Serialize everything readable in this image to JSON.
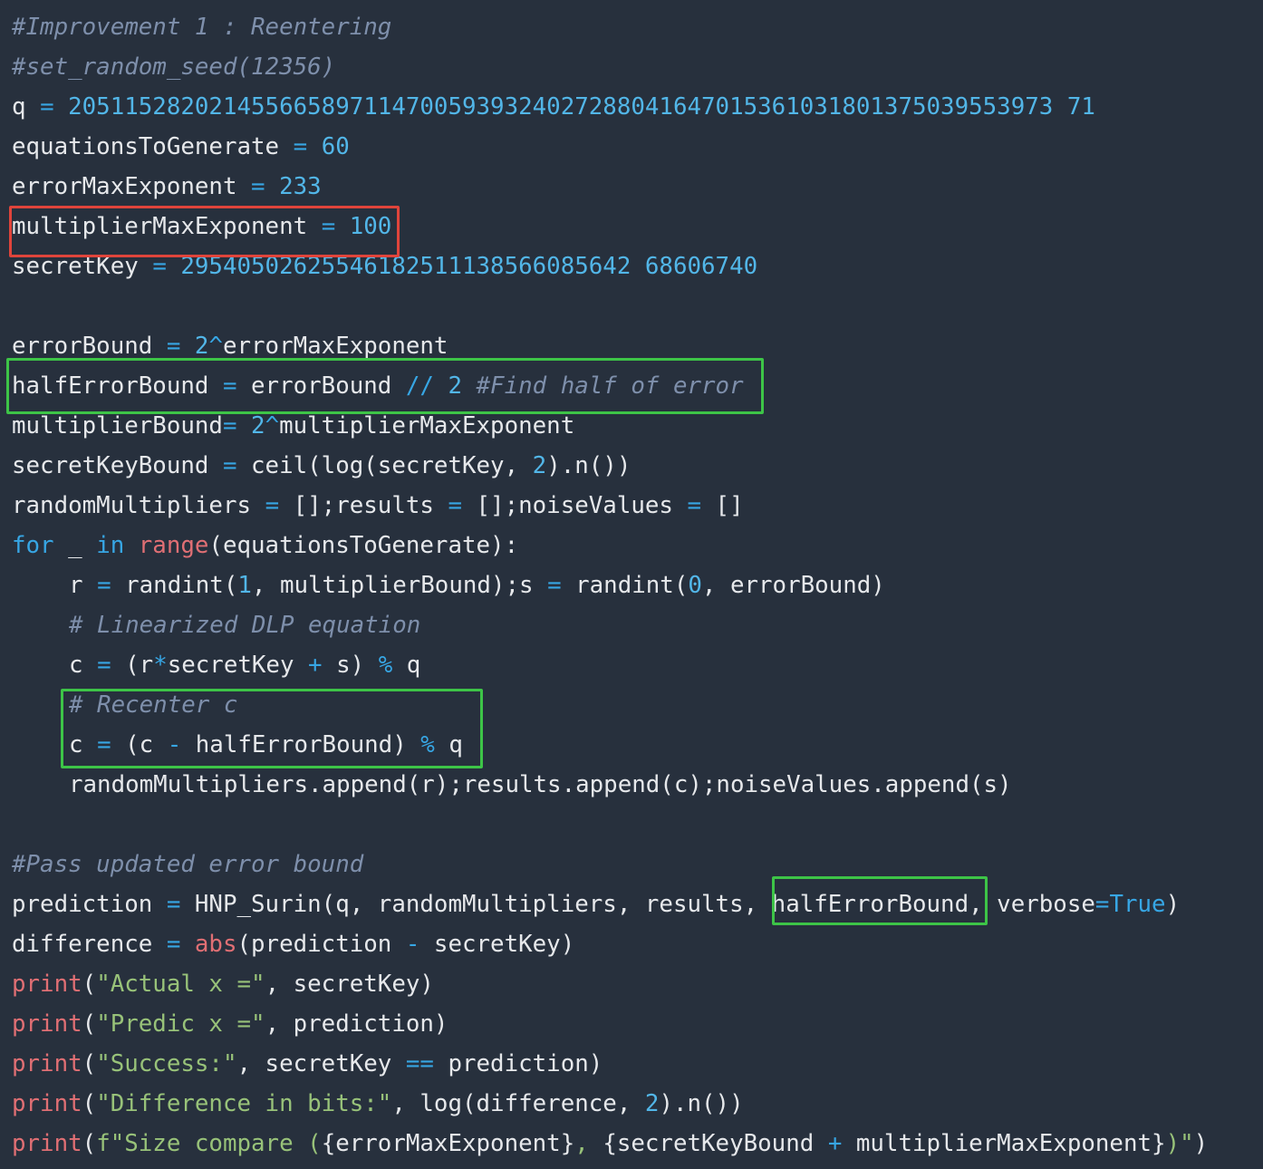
{
  "theme": {
    "background": "#27303d",
    "plain": "#e6e8eb",
    "comment": "#7e8fab",
    "keyword": "#37a6e4",
    "number": "#52b6e8",
    "builtin": "#e06f74",
    "string": "#98c279",
    "highlight_red": "#e0443b",
    "highlight_green": "#3dc447"
  },
  "code": {
    "lines": [
      {
        "indent": false,
        "tokens": [
          {
            "t": "cm",
            "v": "#Improvement 1 : Reentering"
          }
        ]
      },
      {
        "indent": false,
        "tokens": [
          {
            "t": "cm",
            "v": "#set_random_seed(12356)"
          }
        ]
      },
      {
        "indent": false,
        "tokens": [
          {
            "t": "txt",
            "v": "q "
          },
          {
            "t": "op",
            "v": "="
          },
          {
            "t": "txt",
            "v": " "
          },
          {
            "t": "num",
            "v": "2051152820214556658971147005939324027288041647015361031801375039553973 71"
          }
        ]
      },
      {
        "indent": false,
        "tokens": [
          {
            "t": "txt",
            "v": "equationsToGenerate "
          },
          {
            "t": "op",
            "v": "="
          },
          {
            "t": "txt",
            "v": " "
          },
          {
            "t": "num",
            "v": "60"
          }
        ]
      },
      {
        "indent": false,
        "tokens": [
          {
            "t": "txt",
            "v": "errorMaxExponent "
          },
          {
            "t": "op",
            "v": "="
          },
          {
            "t": "txt",
            "v": " "
          },
          {
            "t": "num",
            "v": "233"
          }
        ]
      },
      {
        "indent": false,
        "tokens": [
          {
            "t": "txt",
            "v": "multiplierMaxExponent "
          },
          {
            "t": "op",
            "v": "="
          },
          {
            "t": "txt",
            "v": " "
          },
          {
            "t": "num",
            "v": "100"
          }
        ]
      },
      {
        "indent": false,
        "tokens": [
          {
            "t": "txt",
            "v": "secretKey "
          },
          {
            "t": "op",
            "v": "="
          },
          {
            "t": "txt",
            "v": " "
          },
          {
            "t": "num",
            "v": "29540502625546182511138566085642 68606740"
          }
        ]
      },
      {
        "indent": false,
        "tokens": []
      },
      {
        "indent": false,
        "tokens": [
          {
            "t": "txt",
            "v": "errorBound "
          },
          {
            "t": "op",
            "v": "="
          },
          {
            "t": "txt",
            "v": " "
          },
          {
            "t": "num",
            "v": "2"
          },
          {
            "t": "op",
            "v": "^"
          },
          {
            "t": "txt",
            "v": "errorMaxExponent"
          }
        ]
      },
      {
        "indent": false,
        "tokens": [
          {
            "t": "txt",
            "v": "halfErrorBound "
          },
          {
            "t": "op",
            "v": "="
          },
          {
            "t": "txt",
            "v": " errorBound "
          },
          {
            "t": "op",
            "v": "//"
          },
          {
            "t": "txt",
            "v": " "
          },
          {
            "t": "num",
            "v": "2"
          },
          {
            "t": "txt",
            "v": " "
          },
          {
            "t": "cm",
            "v": "#Find half of error"
          }
        ]
      },
      {
        "indent": false,
        "tokens": [
          {
            "t": "txt",
            "v": "multiplierBound"
          },
          {
            "t": "op",
            "v": "="
          },
          {
            "t": "txt",
            "v": " "
          },
          {
            "t": "num",
            "v": "2"
          },
          {
            "t": "op",
            "v": "^"
          },
          {
            "t": "txt",
            "v": "multiplierMaxExponent"
          }
        ]
      },
      {
        "indent": false,
        "tokens": [
          {
            "t": "txt",
            "v": "secretKeyBound "
          },
          {
            "t": "op",
            "v": "="
          },
          {
            "t": "txt",
            "v": " ceil(log(secretKey, "
          },
          {
            "t": "num",
            "v": "2"
          },
          {
            "t": "txt",
            "v": ").n())"
          }
        ]
      },
      {
        "indent": false,
        "tokens": [
          {
            "t": "txt",
            "v": "randomMultipliers "
          },
          {
            "t": "op",
            "v": "="
          },
          {
            "t": "txt",
            "v": " [];results "
          },
          {
            "t": "op",
            "v": "="
          },
          {
            "t": "txt",
            "v": " [];noiseValues "
          },
          {
            "t": "op",
            "v": "="
          },
          {
            "t": "txt",
            "v": " []"
          }
        ]
      },
      {
        "indent": false,
        "tokens": [
          {
            "t": "kw",
            "v": "for"
          },
          {
            "t": "txt",
            "v": " _ "
          },
          {
            "t": "kw",
            "v": "in"
          },
          {
            "t": "txt",
            "v": " "
          },
          {
            "t": "fn",
            "v": "range"
          },
          {
            "t": "txt",
            "v": "(equationsToGenerate):"
          }
        ]
      },
      {
        "indent": true,
        "tokens": [
          {
            "t": "txt",
            "v": "r "
          },
          {
            "t": "op",
            "v": "="
          },
          {
            "t": "txt",
            "v": " randint("
          },
          {
            "t": "num",
            "v": "1"
          },
          {
            "t": "txt",
            "v": ", multiplierBound);s "
          },
          {
            "t": "op",
            "v": "="
          },
          {
            "t": "txt",
            "v": " randint("
          },
          {
            "t": "num",
            "v": "0"
          },
          {
            "t": "txt",
            "v": ", errorBound)"
          }
        ]
      },
      {
        "indent": true,
        "tokens": [
          {
            "t": "cm",
            "v": "# Linearized DLP equation"
          }
        ]
      },
      {
        "indent": true,
        "tokens": [
          {
            "t": "txt",
            "v": "c "
          },
          {
            "t": "op",
            "v": "="
          },
          {
            "t": "txt",
            "v": " (r"
          },
          {
            "t": "op",
            "v": "*"
          },
          {
            "t": "txt",
            "v": "secretKey "
          },
          {
            "t": "op",
            "v": "+"
          },
          {
            "t": "txt",
            "v": " s) "
          },
          {
            "t": "op",
            "v": "%"
          },
          {
            "t": "txt",
            "v": " q"
          }
        ]
      },
      {
        "indent": true,
        "tokens": [
          {
            "t": "cm",
            "v": "# Recenter c"
          }
        ]
      },
      {
        "indent": true,
        "tokens": [
          {
            "t": "txt",
            "v": "c "
          },
          {
            "t": "op",
            "v": "="
          },
          {
            "t": "txt",
            "v": " (c "
          },
          {
            "t": "op",
            "v": "-"
          },
          {
            "t": "txt",
            "v": " halfErrorBound) "
          },
          {
            "t": "op",
            "v": "%"
          },
          {
            "t": "txt",
            "v": " q"
          }
        ]
      },
      {
        "indent": true,
        "tokens": [
          {
            "t": "txt",
            "v": "randomMultipliers.append(r);results.append(c);noiseValues.append(s)"
          }
        ]
      },
      {
        "indent": false,
        "tokens": []
      },
      {
        "indent": false,
        "tokens": [
          {
            "t": "cm",
            "v": "#Pass updated error bound"
          }
        ]
      },
      {
        "indent": false,
        "tokens": [
          {
            "t": "txt",
            "v": "prediction "
          },
          {
            "t": "op",
            "v": "="
          },
          {
            "t": "txt",
            "v": " HNP_Surin(q, randomMultipliers, results, halfErrorBound, verbose"
          },
          {
            "t": "op",
            "v": "="
          },
          {
            "t": "kw",
            "v": "True"
          },
          {
            "t": "txt",
            "v": ")"
          }
        ]
      },
      {
        "indent": false,
        "tokens": [
          {
            "t": "txt",
            "v": "difference "
          },
          {
            "t": "op",
            "v": "="
          },
          {
            "t": "txt",
            "v": " "
          },
          {
            "t": "fn",
            "v": "abs"
          },
          {
            "t": "txt",
            "v": "(prediction "
          },
          {
            "t": "op",
            "v": "-"
          },
          {
            "t": "txt",
            "v": " secretKey)"
          }
        ]
      },
      {
        "indent": false,
        "tokens": [
          {
            "t": "fn",
            "v": "print"
          },
          {
            "t": "txt",
            "v": "("
          },
          {
            "t": "str",
            "v": "\"Actual x =\""
          },
          {
            "t": "txt",
            "v": ", secretKey)"
          }
        ]
      },
      {
        "indent": false,
        "tokens": [
          {
            "t": "fn",
            "v": "print"
          },
          {
            "t": "txt",
            "v": "("
          },
          {
            "t": "str",
            "v": "\"Predic x =\""
          },
          {
            "t": "txt",
            "v": ", prediction)"
          }
        ]
      },
      {
        "indent": false,
        "tokens": [
          {
            "t": "fn",
            "v": "print"
          },
          {
            "t": "txt",
            "v": "("
          },
          {
            "t": "str",
            "v": "\"Success:\""
          },
          {
            "t": "txt",
            "v": ", secretKey "
          },
          {
            "t": "op",
            "v": "=="
          },
          {
            "t": "txt",
            "v": " prediction)"
          }
        ]
      },
      {
        "indent": false,
        "tokens": [
          {
            "t": "fn",
            "v": "print"
          },
          {
            "t": "txt",
            "v": "("
          },
          {
            "t": "str",
            "v": "\"Difference in bits:\""
          },
          {
            "t": "txt",
            "v": ", log(difference, "
          },
          {
            "t": "num",
            "v": "2"
          },
          {
            "t": "txt",
            "v": ").n())"
          }
        ]
      },
      {
        "indent": false,
        "tokens": [
          {
            "t": "fn",
            "v": "print"
          },
          {
            "t": "txt",
            "v": "("
          },
          {
            "t": "str",
            "v": "f\"Size compare ("
          },
          {
            "t": "txt",
            "v": "{errorMaxExponent}"
          },
          {
            "t": "str",
            "v": ", "
          },
          {
            "t": "txt",
            "v": "{secretKeyBound "
          },
          {
            "t": "op",
            "v": "+"
          },
          {
            "t": "txt",
            "v": " multiplierMaxExponent}"
          },
          {
            "t": "str",
            "v": ")\""
          },
          {
            "t": "txt",
            "v": ")"
          }
        ]
      }
    ]
  }
}
